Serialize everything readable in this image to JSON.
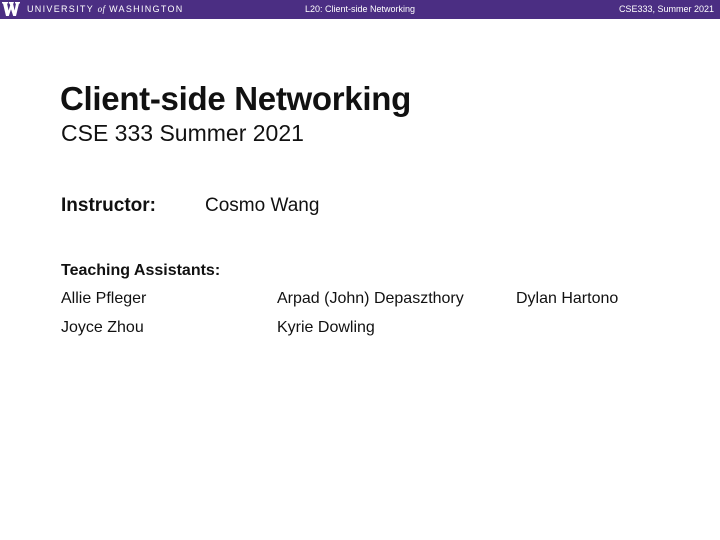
{
  "header": {
    "university_wordmark_left": "UNIVERSITY",
    "university_wordmark_of": "of",
    "university_wordmark_right": "WASHINGTON",
    "lecture": "L20: Client-side Networking",
    "course": "CSE333, Summer 2021",
    "colors": {
      "bar": "#4b2e83",
      "text": "#ffffff"
    },
    "logo_icon": "uw-w-logo-icon"
  },
  "slide": {
    "title": "Client-side Networking",
    "subtitle": "CSE 333 Summer 2021",
    "instructor_label": "Instructor:",
    "instructor_name": "Cosmo Wang",
    "ta_heading": "Teaching Assistants:",
    "tas": [
      "Allie Pfleger",
      "Arpad (John) Depaszthory",
      "Dylan Hartono",
      "Joyce Zhou",
      "Kyrie Dowling"
    ]
  }
}
